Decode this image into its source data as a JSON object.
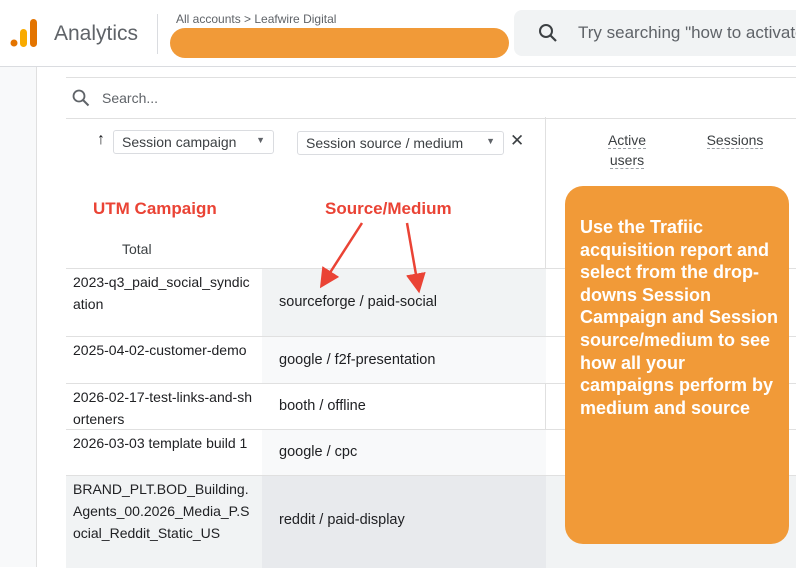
{
  "app": {
    "title": "Analytics"
  },
  "header": {
    "breadcrumb": "All accounts > Leafwire Digital",
    "search_placeholder": "Try searching \"how to activate"
  },
  "table": {
    "search_placeholder": "Search...",
    "dimension1": "Session campaign",
    "dimension2": "Session source / medium",
    "metrics": {
      "active_line1": "Active",
      "active_line2": "users",
      "sessions": "Sessions"
    },
    "total_label": "Total",
    "rows": [
      {
        "campaign": "2023-q3_paid_social_syndication",
        "source": "sourceforge / paid-social"
      },
      {
        "campaign": "2025-04-02-customer-demo",
        "source": "google / f2f-presentation"
      },
      {
        "campaign": "2026-02-17-test-links-and-shorteners",
        "source": "booth / offline"
      },
      {
        "campaign": "2026-03-03 template build 1",
        "source": "google / cpc"
      },
      {
        "campaign": "BRAND_PLT.BOD_Building.Agents_00.2026_Media_P.Social_Reddit_Static_US",
        "source": "reddit / paid-display"
      }
    ]
  },
  "annotations": {
    "utm": "UTM Campaign",
    "source_medium": "Source/Medium",
    "callout": "Use the Trafiic acquisition report and select from the drop-downs Session Campaign and Session source/medium to see how all your campaigns perform by medium and source"
  },
  "colors": {
    "accent": "#f19a38",
    "annotation_red": "#ea4335",
    "logo_orange": "#f9ab00",
    "logo_dark_orange": "#e37400"
  }
}
